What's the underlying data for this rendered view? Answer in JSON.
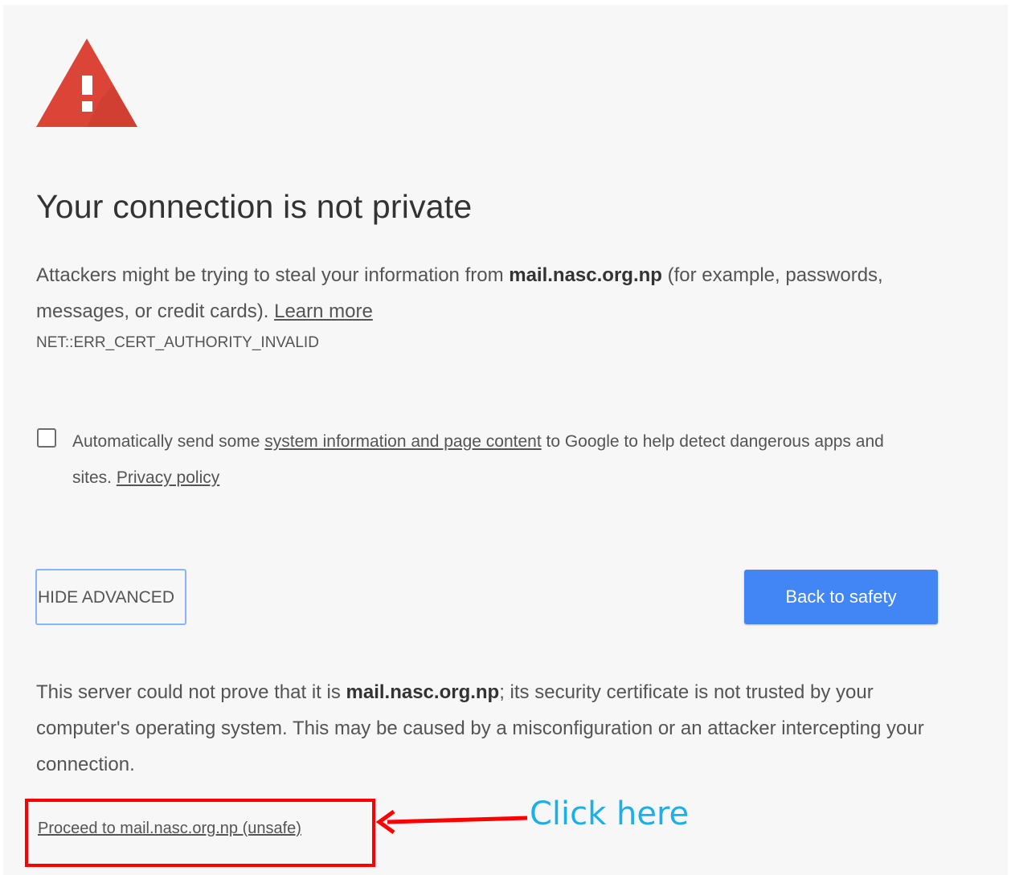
{
  "icons": {
    "warning": "warning-triangle-icon",
    "checkbox": "checkbox-icon",
    "arrow": "arrow-left-icon"
  },
  "colors": {
    "warning_red": "#db4437",
    "primary_blue": "#4285f4",
    "annotation_red": "#ff0000",
    "callout_cyan": "#1ab0e8"
  },
  "interstitial": {
    "title": "Your connection is not private",
    "message": {
      "before_host": "Attackers might be trying to steal your information from ",
      "host": "mail.nasc.org.np",
      "after_host": " (for example, passwords, messages, or credit cards). ",
      "learn_more": "Learn more"
    },
    "error_code": "NET::ERR_CERT_AUTHORITY_INVALID",
    "reporting": {
      "checked": false,
      "prefix": "Automatically send some ",
      "link": "system information and page content",
      "middle": " to Google to help detect dangerous apps and sites. ",
      "privacy_link": "Privacy policy"
    },
    "hide_advanced_label": "HIDE ADVANCED",
    "back_label": "Back to safety",
    "details": {
      "before_host": "This server could not prove that it is ",
      "host": "mail.nasc.org.np",
      "after_host": "; its security certificate is not trusted by your computer's operating system. This may be caused by a misconfiguration or an attacker intercepting your connection."
    },
    "proceed_link": "Proceed to mail.nasc.org.np (unsafe)"
  },
  "annotation": {
    "callout": "Click here"
  }
}
